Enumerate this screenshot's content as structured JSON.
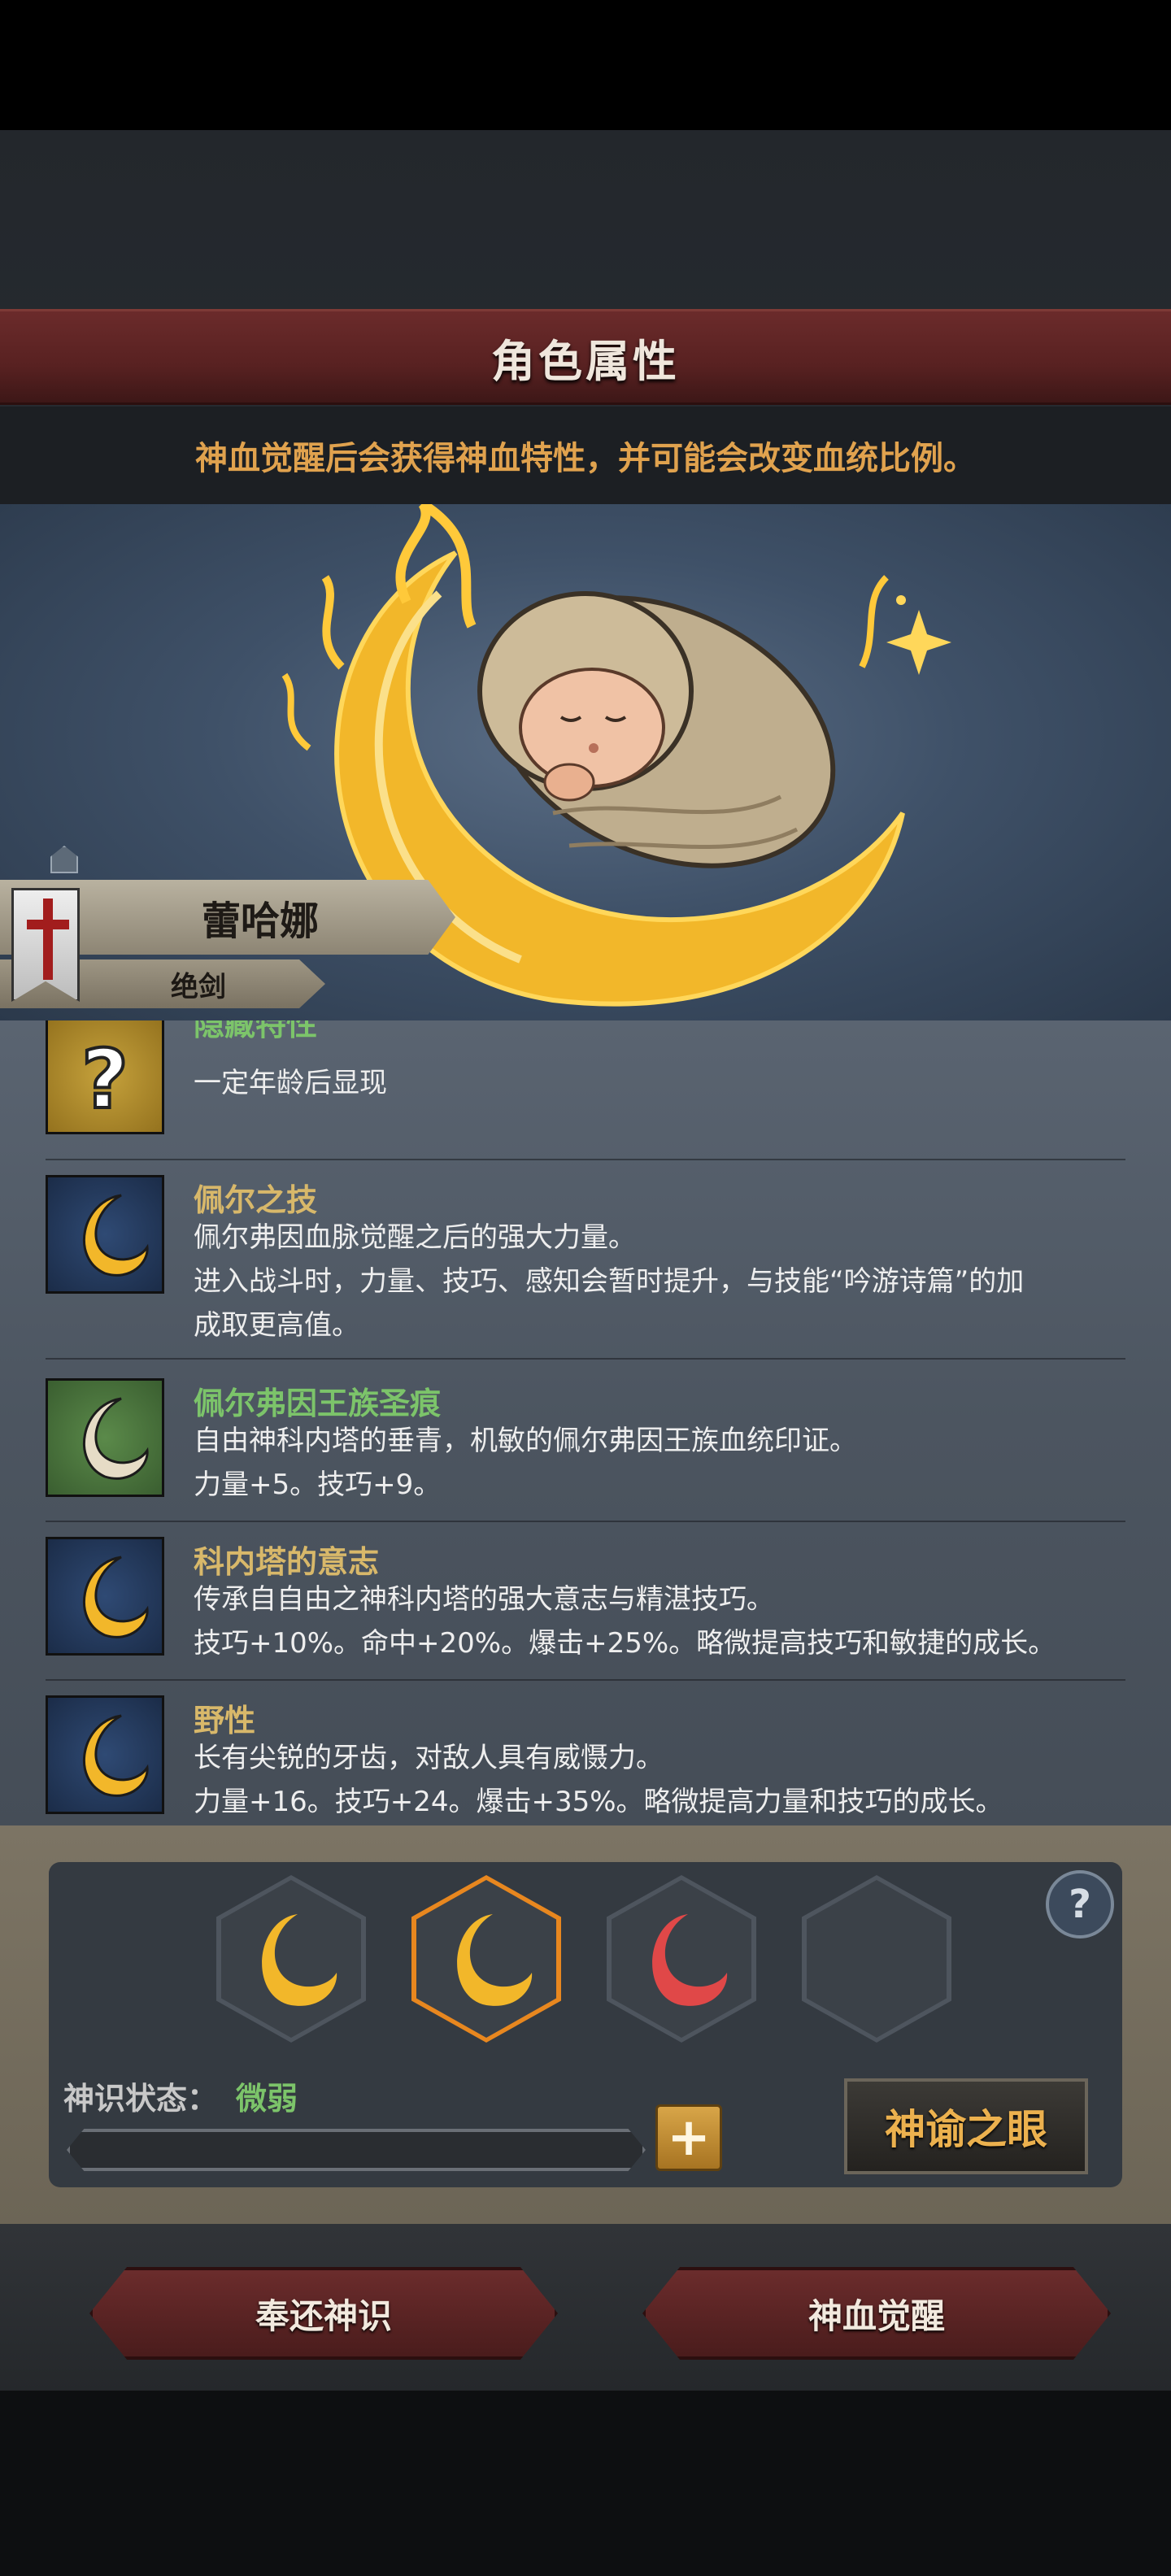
{
  "header": {
    "title": "角色属性",
    "subtitle": "神血觉醒后会获得神血特性，并可能会改变血统比例。"
  },
  "character": {
    "name": "蕾哈娜",
    "class": "绝剑"
  },
  "traits": [
    {
      "name": "隐藏特性",
      "desc": [
        "一定年龄后显现"
      ],
      "icon": "question-mark-icon",
      "name_color": "#7cc46a"
    },
    {
      "name": "佩尔之技",
      "desc": [
        "佩尔弗因血脉觉醒之后的强大力量。",
        "进入战斗时，力量、技巧、感知会暂时提升，与技能“吟游诗篇”的加",
        "成取更高值。"
      ],
      "icon": "crescent-moon-icon"
    },
    {
      "name": "佩尔弗因王族圣痕",
      "desc": [
        "自由神科内塔的垂青，机敏的佩尔弗因王族血统印证。",
        "力量+5。技巧+9。"
      ],
      "icon": "white-crescent-icon",
      "name_color": "#7cc46a"
    },
    {
      "name": "科内塔的意志",
      "desc": [
        "传承自自由之神科内塔的强大意志与精湛技巧。",
        "技巧+10%。命中+20%。爆击+25%。略微提高技巧和敏捷的成长。"
      ],
      "icon": "crescent-moon-icon"
    },
    {
      "name": "野性",
      "desc": [
        "长有尖锐的牙齿，对敌人具有威慑力。",
        "力量+16。技巧+24。爆击+35%。略微提高力量和技巧的成长。"
      ],
      "icon": "crescent-moon-icon"
    }
  ],
  "runes": {
    "slots": [
      "gold-crescent-rune",
      "gold-crescent-rune-selected",
      "red-crescent-rune",
      "empty-slot"
    ],
    "status_label": "神识状态：",
    "status_value": "微弱",
    "progress": 0.0,
    "oracle_label": "神谕之眼",
    "help": "?"
  },
  "actions": {
    "return_label": "奉还神识",
    "awaken_label": "神血觉醒"
  },
  "colors": {
    "accent_gold": "#e0a24e",
    "status_green": "#7cc46a",
    "banner_red": "#5a2222",
    "selected_orange": "#e8871f"
  }
}
